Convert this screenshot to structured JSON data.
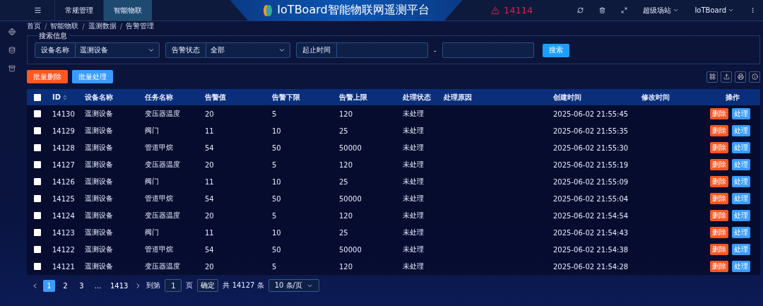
{
  "header": {
    "menu_tabs": [
      {
        "label": "常规管理",
        "selected": false
      },
      {
        "label": "智能物联",
        "selected": true
      }
    ],
    "title": "IoTBoard智能物联网遥测平台",
    "alarm_count": "14114",
    "site": "超级场站",
    "user": "IoTBoard"
  },
  "breadcrumb": [
    {
      "label": "首页"
    },
    {
      "separator": "/",
      "label": "智能物联"
    },
    {
      "separator": "/",
      "label": "遥测数据"
    },
    {
      "separator": "/",
      "label": "告警管理"
    }
  ],
  "search": {
    "legend": "搜索信息",
    "device_label": "设备名称",
    "device_value": "遥测设备",
    "status_label": "告警状态",
    "status_value": "全部",
    "time_label": "起止时间",
    "time_separator": "-",
    "button": "搜索"
  },
  "actions": [
    "批量删除",
    "批量处理"
  ],
  "table": {
    "header_checked": false,
    "columns": [
      "ID",
      "设备名称",
      "任务名称",
      "告警值",
      "告警下限",
      "告警上限",
      "处理状态",
      "处理原因",
      "创建时间",
      "修改时间",
      "操作"
    ],
    "rows": [
      {
        "checked": false,
        "cells": [
          "14130",
          "遥测设备",
          "变压器温度",
          "20",
          "5",
          "120",
          "未处理",
          "",
          "2025-06-02 21:55:45",
          ""
        ],
        "actions": [
          "删除",
          "处理"
        ]
      },
      {
        "checked": false,
        "cells": [
          "14129",
          "遥测设备",
          "阀门",
          "11",
          "10",
          "25",
          "未处理",
          "",
          "2025-06-02 21:55:35",
          ""
        ],
        "actions": [
          "删除",
          "处理"
        ]
      },
      {
        "checked": false,
        "cells": [
          "14128",
          "遥测设备",
          "管道甲烷",
          "54",
          "50",
          "50000",
          "未处理",
          "",
          "2025-06-02 21:55:30",
          ""
        ],
        "actions": [
          "删除",
          "处理"
        ]
      },
      {
        "checked": false,
        "cells": [
          "14127",
          "遥测设备",
          "变压器温度",
          "20",
          "5",
          "120",
          "未处理",
          "",
          "2025-06-02 21:55:19",
          ""
        ],
        "actions": [
          "删除",
          "处理"
        ]
      },
      {
        "checked": false,
        "cells": [
          "14126",
          "遥测设备",
          "阀门",
          "11",
          "10",
          "25",
          "未处理",
          "",
          "2025-06-02 21:55:09",
          ""
        ],
        "actions": [
          "删除",
          "处理"
        ]
      },
      {
        "checked": false,
        "cells": [
          "14125",
          "遥测设备",
          "管道甲烷",
          "54",
          "50",
          "50000",
          "未处理",
          "",
          "2025-06-02 21:55:04",
          ""
        ],
        "actions": [
          "删除",
          "处理"
        ]
      },
      {
        "checked": false,
        "cells": [
          "14124",
          "遥测设备",
          "变压器温度",
          "20",
          "5",
          "120",
          "未处理",
          "",
          "2025-06-02 21:54:54",
          ""
        ],
        "actions": [
          "删除",
          "处理"
        ]
      },
      {
        "checked": false,
        "cells": [
          "14123",
          "遥测设备",
          "阀门",
          "11",
          "10",
          "25",
          "未处理",
          "",
          "2025-06-02 21:54:43",
          ""
        ],
        "actions": [
          "删除",
          "处理"
        ]
      },
      {
        "checked": false,
        "cells": [
          "14122",
          "遥测设备",
          "管道甲烷",
          "54",
          "50",
          "50000",
          "未处理",
          "",
          "2025-06-02 21:54:38",
          ""
        ],
        "actions": [
          "删除",
          "处理"
        ]
      },
      {
        "checked": false,
        "cells": [
          "14121",
          "遥测设备",
          "变压器温度",
          "20",
          "5",
          "120",
          "未处理",
          "",
          "2025-06-02 21:54:28",
          ""
        ],
        "actions": [
          "删除",
          "处理"
        ]
      }
    ]
  },
  "pagination": {
    "pages": [
      {
        "label": "1",
        "selected": true
      },
      {
        "label": "2",
        "selected": false
      },
      {
        "label": "3",
        "selected": false
      },
      {
        "label": "...",
        "selected": false
      },
      {
        "label": "1413",
        "selected": false
      }
    ],
    "goto_label": "到第",
    "goto_value": "1",
    "page_unit": "页",
    "confirm": "确定",
    "total": "共 14127 条",
    "page_size": "10 条/页"
  }
}
